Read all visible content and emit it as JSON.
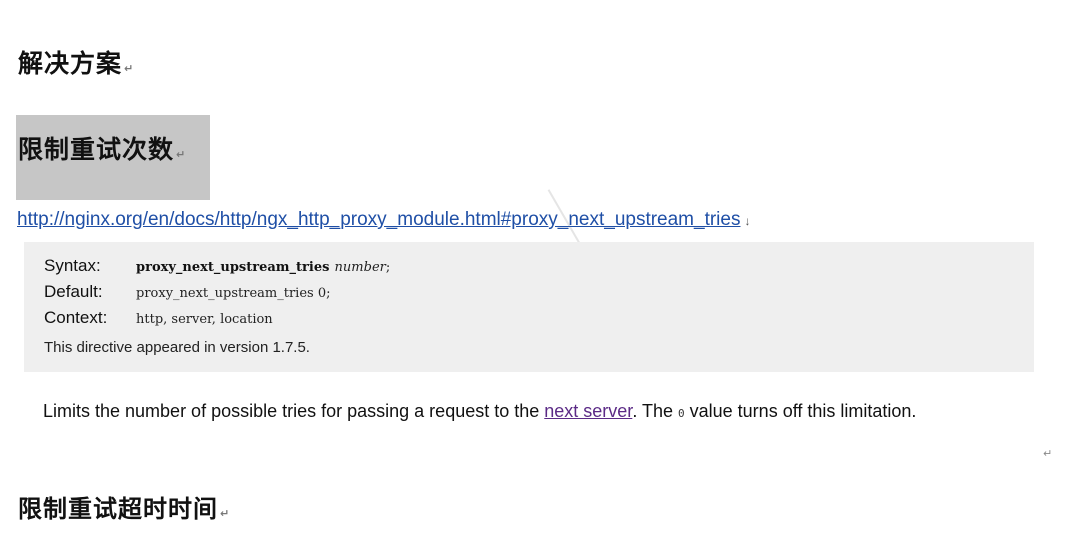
{
  "section_heading": "解决方案",
  "subsection_heading": "限制重试次数",
  "doc_link": "http://nginx.org/en/docs/http/ngx_http_proxy_module.html#proxy_next_upstream_tries",
  "directive": {
    "syntax_label": "Syntax:",
    "syntax_name": "proxy_next_upstream_tries",
    "syntax_param": "number",
    "syntax_end": ";",
    "default_label": "Default:",
    "default_value": "proxy_next_upstream_tries 0;",
    "context_label": "Context:",
    "context_value": "http, server, location",
    "version_note": "This directive appeared in version 1.7.5."
  },
  "description": {
    "part1": "Limits the number of possible tries for passing a request to the ",
    "link_text": "next server",
    "part2": ". The ",
    "code_value": "0",
    "part3": " value turns off this limitation."
  },
  "next_heading": "限制重试超时时间",
  "colors": {
    "link": "#1f4fa6",
    "visited_link": "#5b2a86",
    "heading_highlight": "#c6c6c6",
    "directive_background": "#efefef"
  }
}
